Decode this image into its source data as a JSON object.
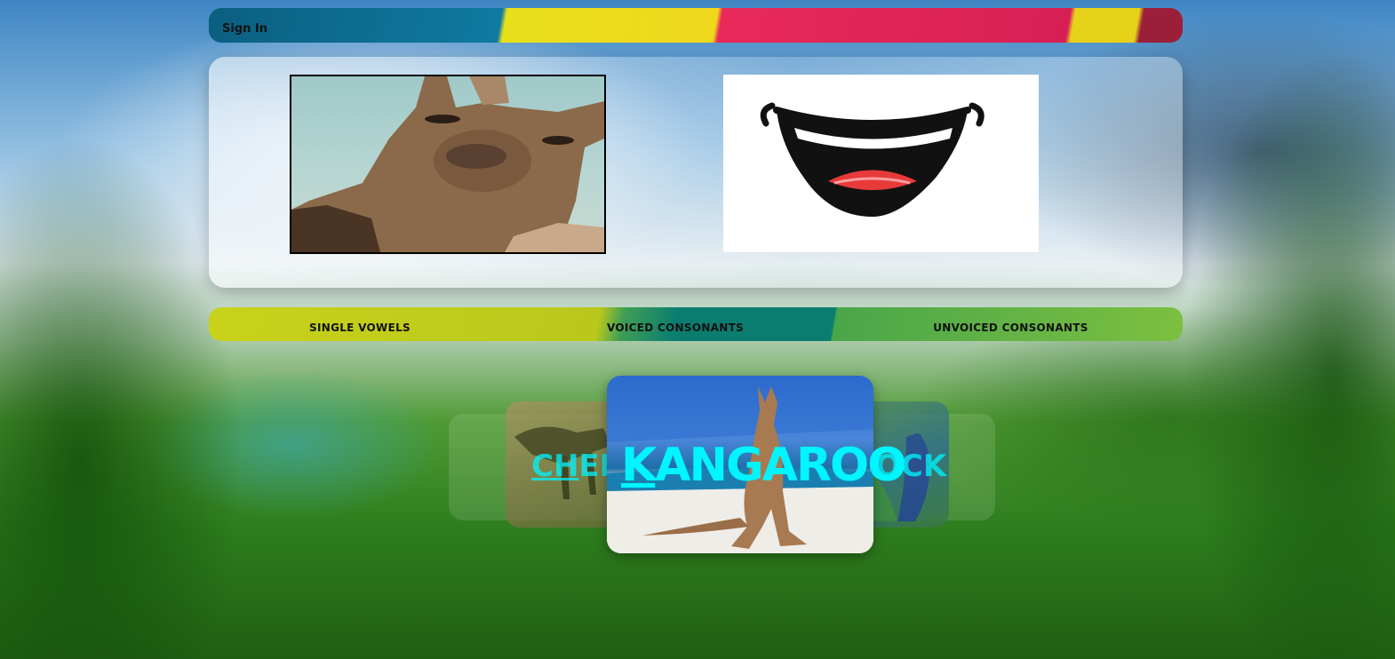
{
  "header": {
    "sign_in": "Sign In"
  },
  "tabs": [
    {
      "label": "SINGLE VOWELS"
    },
    {
      "label": "VOICED CONSONANTS"
    },
    {
      "label": "UNVOICED CONSONANTS"
    }
  ],
  "carousel": {
    "current": {
      "first_letter": "K",
      "rest": "ANGAROO"
    },
    "previous": {
      "first_letter": "CH",
      "rest": "EE"
    },
    "next": {
      "text": "OCK"
    }
  },
  "colors": {
    "word_color": "#00f5ff",
    "topbar_blue": "#0b5f80",
    "topbar_yellow": "#e8e01a",
    "topbar_pink": "#e8295a",
    "tabs_lime": "#c9d21a",
    "tabs_teal": "#0a7d70",
    "tabs_green": "#7cc040"
  }
}
